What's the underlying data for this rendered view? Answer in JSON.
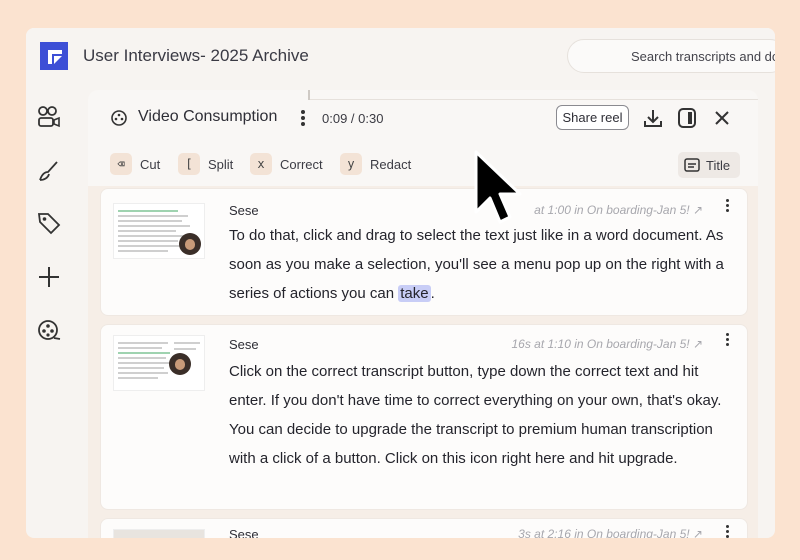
{
  "app": {
    "title": "User Interviews- 2025 Archive",
    "search_placeholder": "Search transcripts and do"
  },
  "sidebar": {
    "icons": [
      "users-video-icon",
      "brush-icon",
      "tag-icon",
      "plus-icon",
      "film-reel-icon"
    ]
  },
  "panel": {
    "title": "Video Consumption",
    "timecode": "0:09 / 0:30",
    "share_label": "Share reel"
  },
  "toolbar": {
    "cut_key": "⌫",
    "cut_label": "Cut",
    "split_key": "[",
    "split_label": "Split",
    "correct_key": "x",
    "correct_label": "Correct",
    "redact_key": "y",
    "redact_label": "Redact",
    "title_label": "Title"
  },
  "cards": [
    {
      "speaker": "Sese",
      "meta": "at 1:00 in On boarding-Jan 5! ↗",
      "text_before": "To do that, click and drag to select the text just like in a word document. As soon as you make a selection, you'll see a menu pop up on the right with a series of actions you can ",
      "text_highlight": "take",
      "text_after": "."
    },
    {
      "speaker": "Sese",
      "meta": "16s at 1:10 in On boarding-Jan 5! ↗",
      "text_before": "Click on the correct transcript button, type down the correct text and hit enter. If you don't have time to correct everything on your own, that's okay. You can decide to upgrade the transcript to premium human transcription with a click of a button. Click on this icon right here and hit upgrade.",
      "text_highlight": "",
      "text_after": ""
    },
    {
      "speaker": "Sese",
      "meta": "3s at 2:16 in On boarding-Jan 5! ↗"
    }
  ],
  "colors": {
    "background": "#fbe3d0",
    "brand": "#3d4fd6",
    "highlight": "#c8cdf6"
  }
}
